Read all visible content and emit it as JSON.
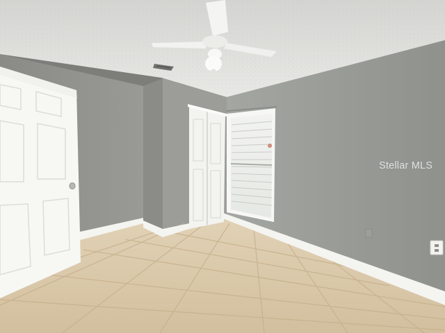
{
  "watermark": {
    "text": "Stellar MLS"
  }
}
